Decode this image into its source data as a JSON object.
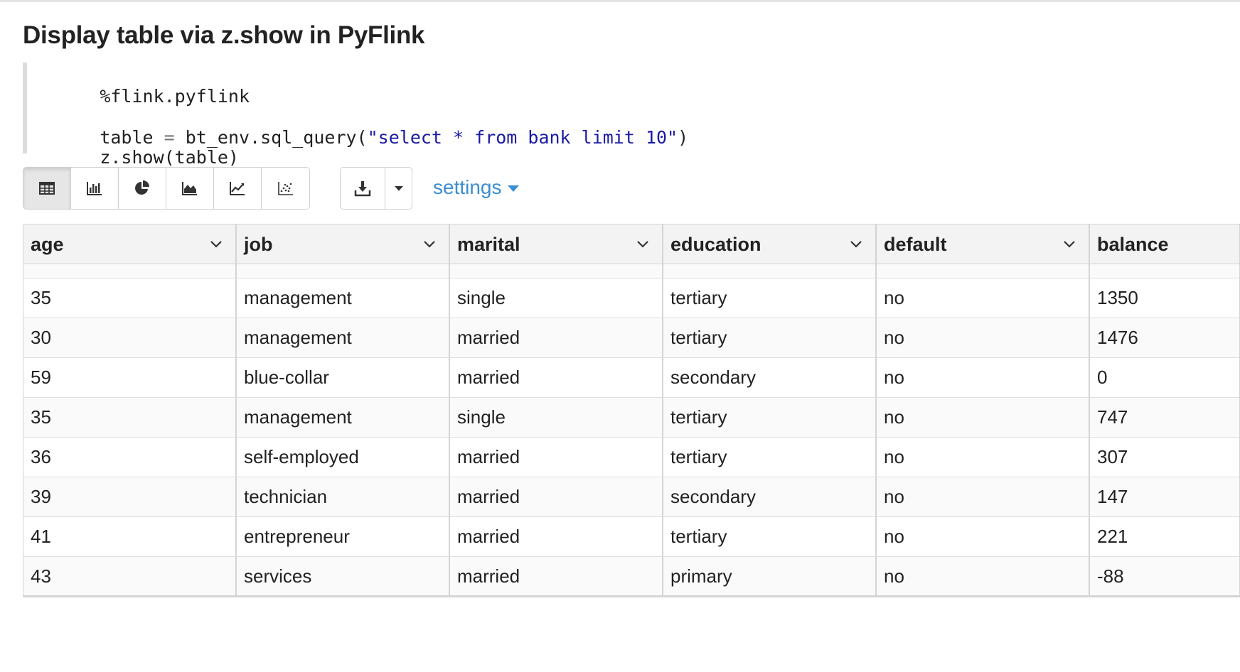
{
  "paragraph": {
    "title": "Display table via z.show in PyFlink",
    "code": {
      "line1": "%flink.pyflink",
      "line3_a": "table ",
      "line3_op": "=",
      "line3_b": " bt_env.sql_query(",
      "line3_str": "\"select * from bank limit 10\"",
      "line3_c": ")",
      "line4": "z.show(table)"
    }
  },
  "toolbar": {
    "viz_buttons": [
      {
        "icon": "table-icon",
        "active": true
      },
      {
        "icon": "bar-chart-icon",
        "active": false
      },
      {
        "icon": "pie-chart-icon",
        "active": false
      },
      {
        "icon": "area-chart-icon",
        "active": false
      },
      {
        "icon": "line-chart-icon",
        "active": false
      },
      {
        "icon": "scatter-chart-icon",
        "active": false
      }
    ],
    "download_icon": "download-icon",
    "dropdown_icon": "caret-down-icon",
    "settings_label": "settings"
  },
  "table": {
    "columns": [
      "age",
      "job",
      "marital",
      "education",
      "default",
      "balance"
    ],
    "rows": [
      [
        "35",
        "management",
        "single",
        "tertiary",
        "no",
        "1350"
      ],
      [
        "30",
        "management",
        "married",
        "tertiary",
        "no",
        "1476"
      ],
      [
        "59",
        "blue-collar",
        "married",
        "secondary",
        "no",
        "0"
      ],
      [
        "35",
        "management",
        "single",
        "tertiary",
        "no",
        "747"
      ],
      [
        "36",
        "self-employed",
        "married",
        "tertiary",
        "no",
        "307"
      ],
      [
        "39",
        "technician",
        "married",
        "secondary",
        "no",
        "147"
      ],
      [
        "41",
        "entrepreneur",
        "married",
        "tertiary",
        "no",
        "221"
      ],
      [
        "43",
        "services",
        "married",
        "primary",
        "no",
        "-88"
      ]
    ]
  },
  "colors": {
    "accent": "#3b8ed3",
    "string_literal": "#1a1aa6",
    "header_bg": "#f3f3f3"
  }
}
